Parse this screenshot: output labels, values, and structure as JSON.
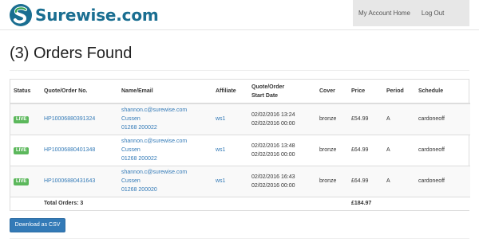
{
  "brand": {
    "name": "Surewise.com",
    "colors": {
      "primary": "#1a6e91",
      "accent": "#2fa04a"
    }
  },
  "nav": {
    "account": "My Account Home",
    "logout": "Log Out"
  },
  "page": {
    "title": "(3) Orders Found"
  },
  "table": {
    "headers": {
      "status": "Status",
      "quote": "Quote/Order No.",
      "name": "Name/Email",
      "affiliate": "Affiliate",
      "start_line1": "Quote/Order",
      "start_line2": "Start Date",
      "cover": "Cover",
      "price": "Price",
      "period": "Period",
      "schedule": "Schedule"
    },
    "rows": [
      {
        "status": "LIVE",
        "quote_no": "HP10006880391324",
        "email": "shannon.c@surewise.com",
        "surname": "Cussen",
        "phone": "01268 200022",
        "affiliate": "ws1",
        "quote_date": "02/02/2016 13:24",
        "start_date": "02/02/2016 00:00",
        "cover": "bronze",
        "price": "£54.99",
        "period": "A",
        "schedule": "cardoneoff"
      },
      {
        "status": "LIVE",
        "quote_no": "HP10006880401348",
        "email": "shannon.c@surewise.com",
        "surname": "Cussen",
        "phone": "01268 200022",
        "affiliate": "ws1",
        "quote_date": "02/02/2016 13:48",
        "start_date": "02/02/2016 00:00",
        "cover": "bronze",
        "price": "£64.99",
        "period": "A",
        "schedule": "cardoneoff"
      },
      {
        "status": "LIVE",
        "quote_no": "HP10006880431643",
        "email": "shannon.c@surewise.com",
        "surname": "Cussen",
        "phone": "01268 200020",
        "affiliate": "ws1",
        "quote_date": "02/02/2016 16:43",
        "start_date": "02/02/2016 00:00",
        "cover": "bronze",
        "price": "£64.99",
        "period": "A",
        "schedule": "cardoneoff"
      }
    ],
    "total_label": "Total Orders: 3",
    "total_price": "£184.97"
  },
  "actions": {
    "download_csv": "Download as CSV"
  }
}
